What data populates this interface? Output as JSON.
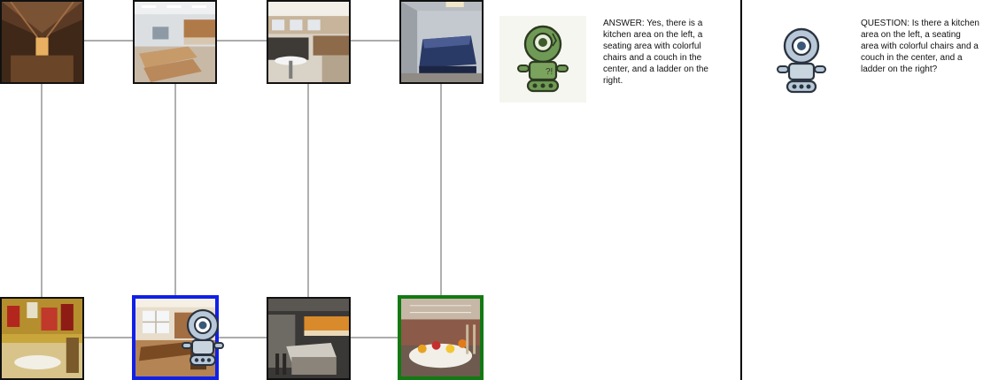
{
  "answer": {
    "text": "ANSWER: Yes, there is a kitchen area on the left, a seating area with colorful chairs and a couch in the center, and a ladder on the right."
  },
  "question": {
    "text": "QUESTION: Is there a kitchen area on the left, a seating area with colorful chairs and a couch in the center, and a ladder on the right?"
  },
  "nodes": [
    {
      "id": "top-1",
      "scene": "attic room with wooden beams"
    },
    {
      "id": "top-2",
      "scene": "break room with tables and kitchen cabinets"
    },
    {
      "id": "top-3",
      "scene": "office with desks and round table"
    },
    {
      "id": "top-4",
      "scene": "bedroom with blue bedding"
    },
    {
      "id": "bottom-1",
      "scene": "yellow bathroom with red decor"
    },
    {
      "id": "bottom-2",
      "scene": "office with window and desk",
      "status": "current"
    },
    {
      "id": "bottom-3",
      "scene": "modern kitchen with counter"
    },
    {
      "id": "bottom-4",
      "scene": "lounge with colorful chairs",
      "status": "target"
    }
  ],
  "colors": {
    "current_border": "#1020e8",
    "target_border": "#127a12",
    "edge": "#7b7b7b",
    "answer_robot": "#5f8d47",
    "question_robot": "#3a4a5a"
  },
  "icons": {
    "answer_speaker": "green-robot-icon",
    "question_speaker": "blue-robot-icon",
    "agent": "agent-robot-icon"
  }
}
